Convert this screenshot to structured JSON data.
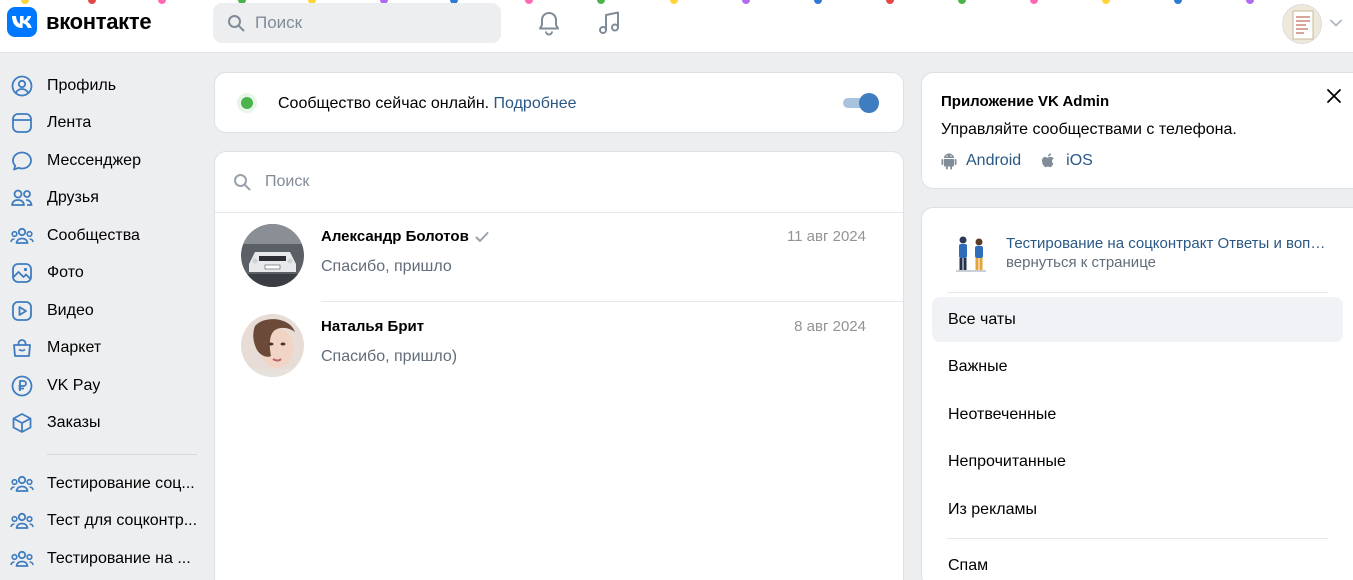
{
  "header": {
    "logo_text": "вконтакте",
    "search_placeholder": "Поиск"
  },
  "nav": {
    "items": [
      {
        "label": "Профиль",
        "icon": "profile-icon"
      },
      {
        "label": "Лента",
        "icon": "feed-icon"
      },
      {
        "label": "Мессенджер",
        "icon": "messenger-icon"
      },
      {
        "label": "Друзья",
        "icon": "friends-icon"
      },
      {
        "label": "Сообщества",
        "icon": "communities-icon"
      },
      {
        "label": "Фото",
        "icon": "photo-icon"
      },
      {
        "label": "Видео",
        "icon": "video-icon"
      },
      {
        "label": "Маркет",
        "icon": "market-icon"
      },
      {
        "label": "VK Pay",
        "icon": "vkpay-icon"
      },
      {
        "label": "Заказы",
        "icon": "orders-icon"
      }
    ],
    "groups": [
      {
        "label": "Тестирование соц..."
      },
      {
        "label": "Тест для соцконтр..."
      },
      {
        "label": "Тестирование на ..."
      }
    ]
  },
  "online": {
    "text": "Сообщество сейчас онлайн.",
    "link": "Подробнее",
    "enabled": true
  },
  "chats": {
    "search_placeholder": "Поиск",
    "items": [
      {
        "name": "Александр Болотов",
        "date": "11 авг 2024",
        "message": "Спасибо, пришло",
        "verified": true
      },
      {
        "name": "Наталья Брит",
        "date": "8 авг 2024",
        "message": "Спасибо, пришло)",
        "verified": false
      }
    ]
  },
  "admin_app": {
    "title": "Приложение VK Admin",
    "subtitle": "Управляйте сообществами с телефона.",
    "android_label": "Android",
    "ios_label": "iOS"
  },
  "group": {
    "name": "Тестирование на соцконтракт Ответы и вопросы",
    "back": "вернуться к странице"
  },
  "filters": [
    {
      "label": "Все чаты",
      "active": true
    },
    {
      "label": "Важные",
      "active": false
    },
    {
      "label": "Неотвеченные",
      "active": false
    },
    {
      "label": "Непрочитанные",
      "active": false
    },
    {
      "label": "Из рекламы",
      "active": false
    },
    {
      "label": "Спам",
      "active": false
    }
  ],
  "colors": {
    "brand": "#0077ff",
    "link": "#2a5885",
    "online": "#4bb34b",
    "nav_icon": "#3f7cc0"
  }
}
